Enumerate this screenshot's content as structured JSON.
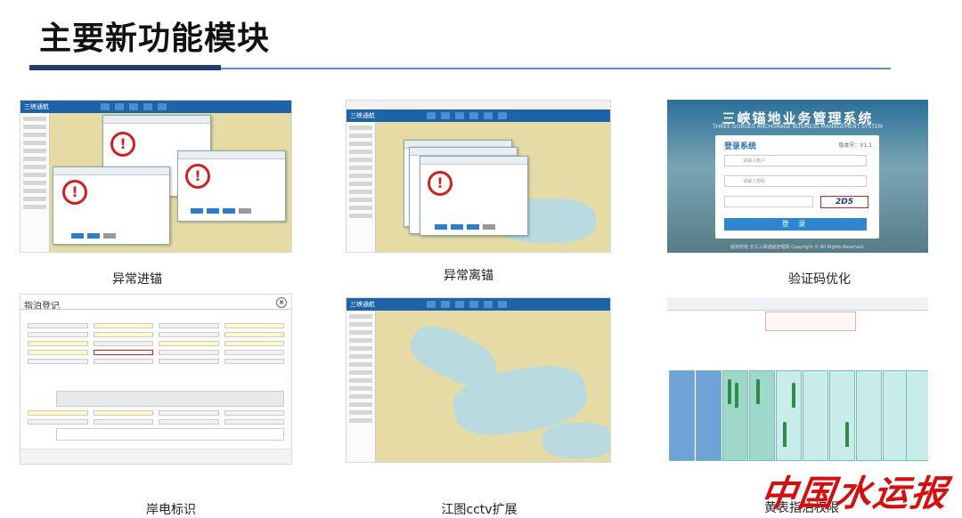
{
  "page": {
    "title": "主要新功能模块"
  },
  "modules": [
    {
      "caption": "异常进锚"
    },
    {
      "caption": "异常离锚"
    },
    {
      "caption": "验证码优化"
    },
    {
      "caption": "岸电标识"
    },
    {
      "caption": "江图cctv扩展"
    },
    {
      "caption": "黄表指泊权限"
    }
  ],
  "login_screen": {
    "system_title": "三峡锚地业务管理系统",
    "system_subtitle": "THREE GORGES ANCHORAGE BUSINESS MANAGEMENT SYSTEM",
    "login_heading": "登录系统",
    "version": "版本号：V1.1",
    "account_placeholder": "请输入账户",
    "password_placeholder": "请输入密码",
    "captcha_text": "2D5",
    "login_button": "登 录",
    "copyright": "版权所有 长江三峡通航管理局 Copyright © All Rights Reserved."
  },
  "form_screen": {
    "title": "指泊登记"
  },
  "watermark": "中国水运报",
  "colors": {
    "title_rule_dark": "#1f3d6b",
    "title_rule_light": "#5e8fc4",
    "warning_red": "#d02020",
    "app_blue": "#1c63a8"
  }
}
